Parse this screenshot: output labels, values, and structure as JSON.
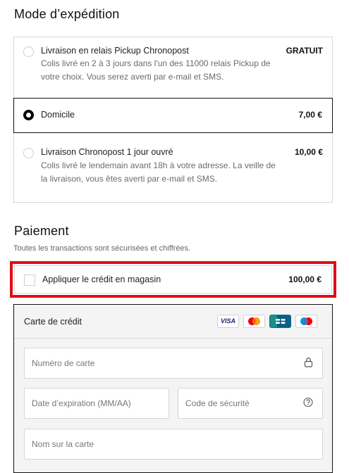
{
  "shipping": {
    "title": "Mode d’expédition",
    "options": [
      {
        "label": "Livraison en relais Pickup Chronopost",
        "price": "GRATUIT",
        "description_lines": [
          "Colis livré en 2 à 3 jours dans l'un des 11000 relais Pickup de",
          "votre choix. Vous serez averti par e-mail et SMS."
        ],
        "selected": false
      },
      {
        "label": "Domicile",
        "price": "7,00 €",
        "selected": true
      },
      {
        "label": "Livraison Chronopost 1 jour ouvré",
        "price": "10,00 €",
        "description_lines": [
          "Colis livré le lendemain avant 18h à votre adresse. La veille de",
          "la livraison, vous êtes averti par e-mail et SMS."
        ],
        "selected": false
      }
    ]
  },
  "payment": {
    "title": "Paiement",
    "subtitle": "Toutes les transactions sont sécurisées et chiffrées.",
    "store_credit": {
      "label": "Appliquer le crédit en magasin",
      "amount": "100,00 €",
      "checked": false
    },
    "credit_card": {
      "label": "Carte de crédit",
      "methods": [
        "visa",
        "mastercard",
        "cartes-bancaires",
        "maestro"
      ],
      "visa_text": "VISA",
      "card_number_placeholder": "Numéro de carte",
      "expiry_placeholder": "Date d’expiration (MM/AA)",
      "security_code_placeholder": "Code de sécurité",
      "name_placeholder": "Nom sur la carte"
    }
  },
  "colors": {
    "highlight_border": "#e10e16",
    "selected_border": "#111111",
    "panel_background": "#f4f4f4"
  },
  "icons": [
    "lock-icon",
    "question-circle-icon",
    "visa-icon",
    "mastercard-icon",
    "cartes-bancaires-icon",
    "maestro-icon"
  ]
}
